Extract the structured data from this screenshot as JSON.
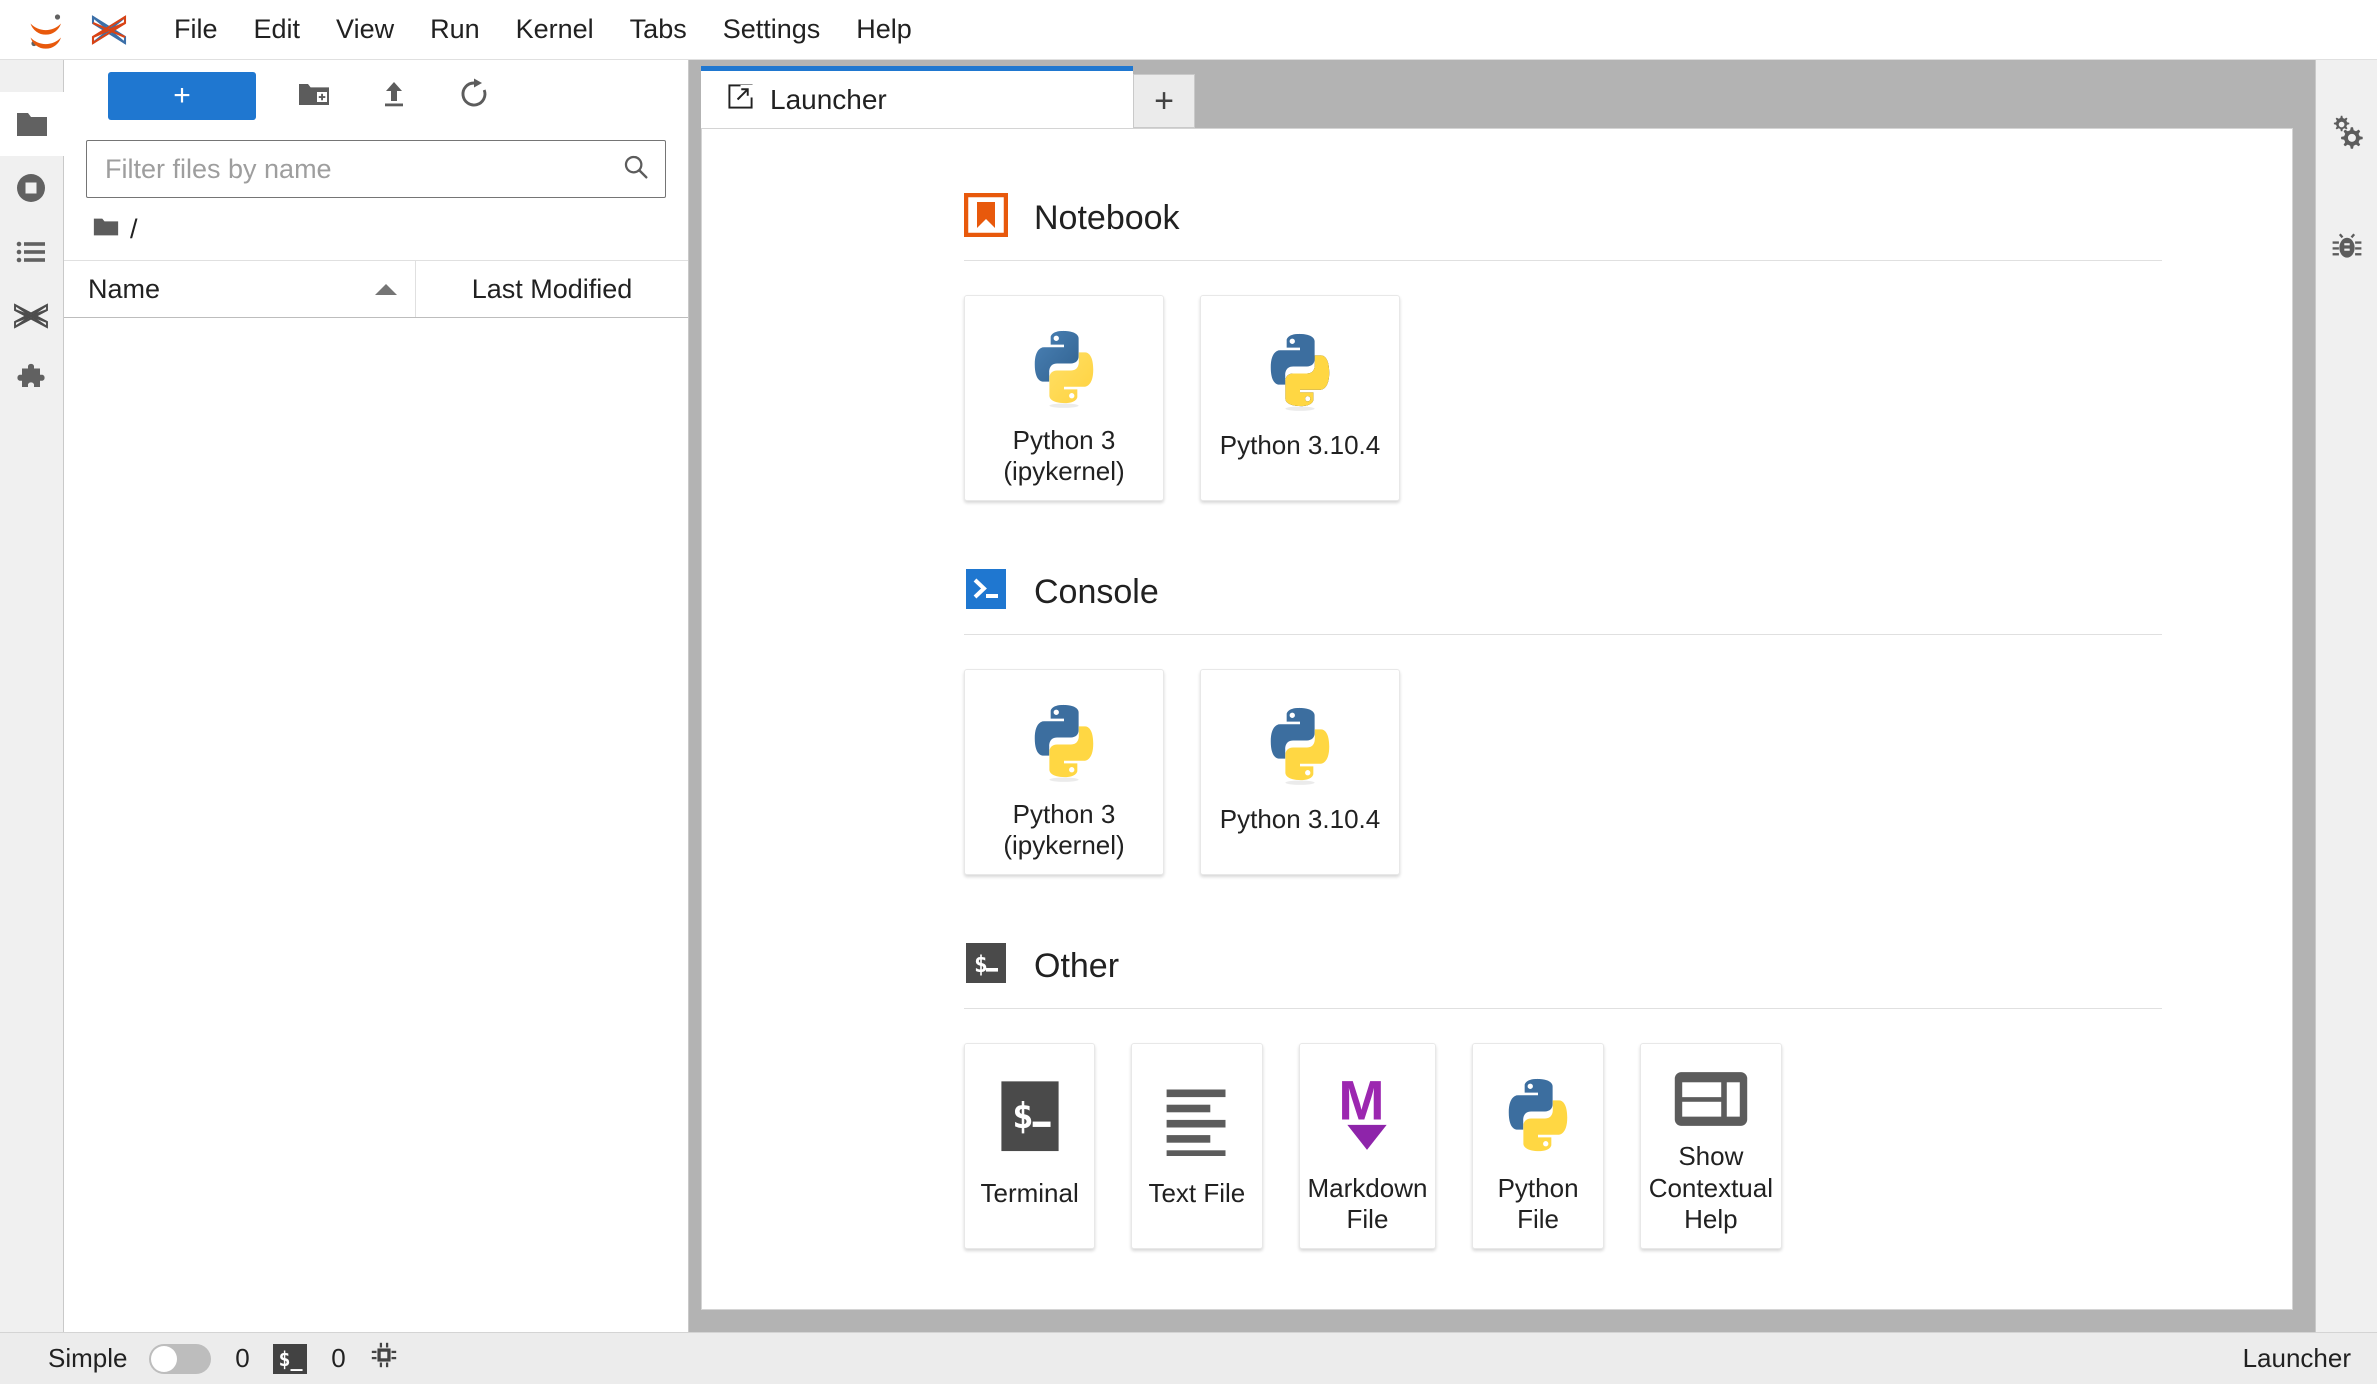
{
  "app": {
    "title": "JupyterLab",
    "logo_jupyter": "jupyter-logo-icon",
    "logo_elyra": "elyra-logo-icon"
  },
  "menubar": {
    "items": [
      {
        "label": "File",
        "name": "menu-file"
      },
      {
        "label": "Edit",
        "name": "menu-edit"
      },
      {
        "label": "View",
        "name": "menu-view"
      },
      {
        "label": "Run",
        "name": "menu-run"
      },
      {
        "label": "Kernel",
        "name": "menu-kernel"
      },
      {
        "label": "Tabs",
        "name": "menu-tabs"
      },
      {
        "label": "Settings",
        "name": "menu-settings"
      },
      {
        "label": "Help",
        "name": "menu-help"
      }
    ]
  },
  "activitybar": {
    "items": [
      {
        "icon": "folder-icon",
        "label": "File Browser",
        "active": true
      },
      {
        "icon": "stop-circle-icon",
        "label": "Running Terminals and Kernels",
        "active": false
      },
      {
        "icon": "list-icon",
        "label": "Table of Contents",
        "active": false
      },
      {
        "icon": "elyra-icon",
        "label": "Elyra",
        "active": false
      },
      {
        "icon": "puzzle-icon",
        "label": "Extension Manager",
        "active": false
      }
    ]
  },
  "filebrowser": {
    "toolbar": {
      "new_label": "+",
      "new_folder_icon": "new-folder-icon",
      "upload_icon": "upload-icon",
      "refresh_icon": "refresh-icon"
    },
    "filter": {
      "placeholder": "Filter files by name",
      "value": "",
      "search_icon": "search-icon"
    },
    "breadcrumb": {
      "root_icon": "folder-icon",
      "path": "/"
    },
    "columns": {
      "name": "Name",
      "last_modified": "Last Modified",
      "sort": "ascending"
    },
    "rows": []
  },
  "dock": {
    "tabs": [
      {
        "label": "Launcher",
        "icon": "launcher-icon",
        "active": true
      }
    ],
    "add_tab_label": "+"
  },
  "launcher": {
    "sections": [
      {
        "name": "notebook",
        "title": "Notebook",
        "icon": "notebook-icon",
        "cards": [
          {
            "label": "Python 3\n(ipykernel)",
            "icon": "python-icon",
            "name": "card-python3-ipykernel-notebook"
          },
          {
            "label": "Python 3.10.4",
            "icon": "python-icon",
            "name": "card-python-3-10-4-notebook"
          }
        ]
      },
      {
        "name": "console",
        "title": "Console",
        "icon": "console-icon",
        "cards": [
          {
            "label": "Python 3\n(ipykernel)",
            "icon": "python-icon",
            "name": "card-python3-ipykernel-console"
          },
          {
            "label": "Python 3.10.4",
            "icon": "python-icon",
            "name": "card-python-3-10-4-console"
          }
        ]
      },
      {
        "name": "other",
        "title": "Other",
        "icon": "other-icon",
        "cards": [
          {
            "label": "Terminal",
            "icon": "terminal-icon",
            "name": "card-terminal"
          },
          {
            "label": "Text File",
            "icon": "text-file-icon",
            "name": "card-text-file"
          },
          {
            "label": "Markdown File",
            "icon": "markdown-icon",
            "name": "card-markdown-file"
          },
          {
            "label": "Python File",
            "icon": "python-icon",
            "name": "card-python-file"
          },
          {
            "label": "Show\nContextual Help",
            "icon": "contextual-help-icon",
            "name": "card-show-contextual-help"
          }
        ]
      }
    ]
  },
  "rightbar": {
    "items": [
      {
        "icon": "gears-icon",
        "label": "Property Inspector"
      },
      {
        "icon": "bug-icon",
        "label": "Debugger"
      }
    ]
  },
  "statusbar": {
    "simple_label": "Simple",
    "simple_on": false,
    "kernel_count": "0",
    "terminal_icon": "terminal-icon",
    "terminal_count": "0",
    "cpu_icon": "chip-icon",
    "current_view": "Launcher"
  },
  "colors": {
    "accent_blue": "#1f77d0",
    "notebook_orange": "#e8590c",
    "markdown_purple": "#9c27b0",
    "python_blue": "#336d9e",
    "python_yellow": "#ffd googol43",
    "dock_gray": "#b3b3b3",
    "panel_gray": "#f0f0f0"
  }
}
